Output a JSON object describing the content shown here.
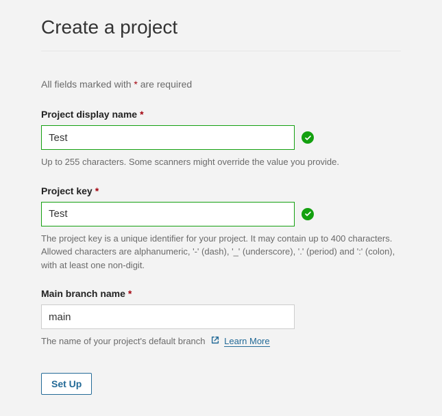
{
  "header": {
    "title": "Create a project"
  },
  "required_note": {
    "prefix": "All fields marked with ",
    "marker": "*",
    "suffix": " are required"
  },
  "fields": {
    "display_name": {
      "label": "Project display name",
      "required_marker": "*",
      "value": "Test",
      "help": "Up to 255 characters. Some scanners might override the value you provide.",
      "valid": true
    },
    "project_key": {
      "label": "Project key",
      "required_marker": "*",
      "value": "Test",
      "help": "The project key is a unique identifier for your project. It may contain up to 400 characters. Allowed characters are alphanumeric, '-' (dash), '_' (underscore), '.' (period) and ':' (colon), with at least one non-digit.",
      "valid": true
    },
    "main_branch": {
      "label": "Main branch name",
      "required_marker": "*",
      "value": "main",
      "help": "The name of your project's default branch",
      "learn_more": "Learn More"
    }
  },
  "actions": {
    "setup_label": "Set Up"
  }
}
